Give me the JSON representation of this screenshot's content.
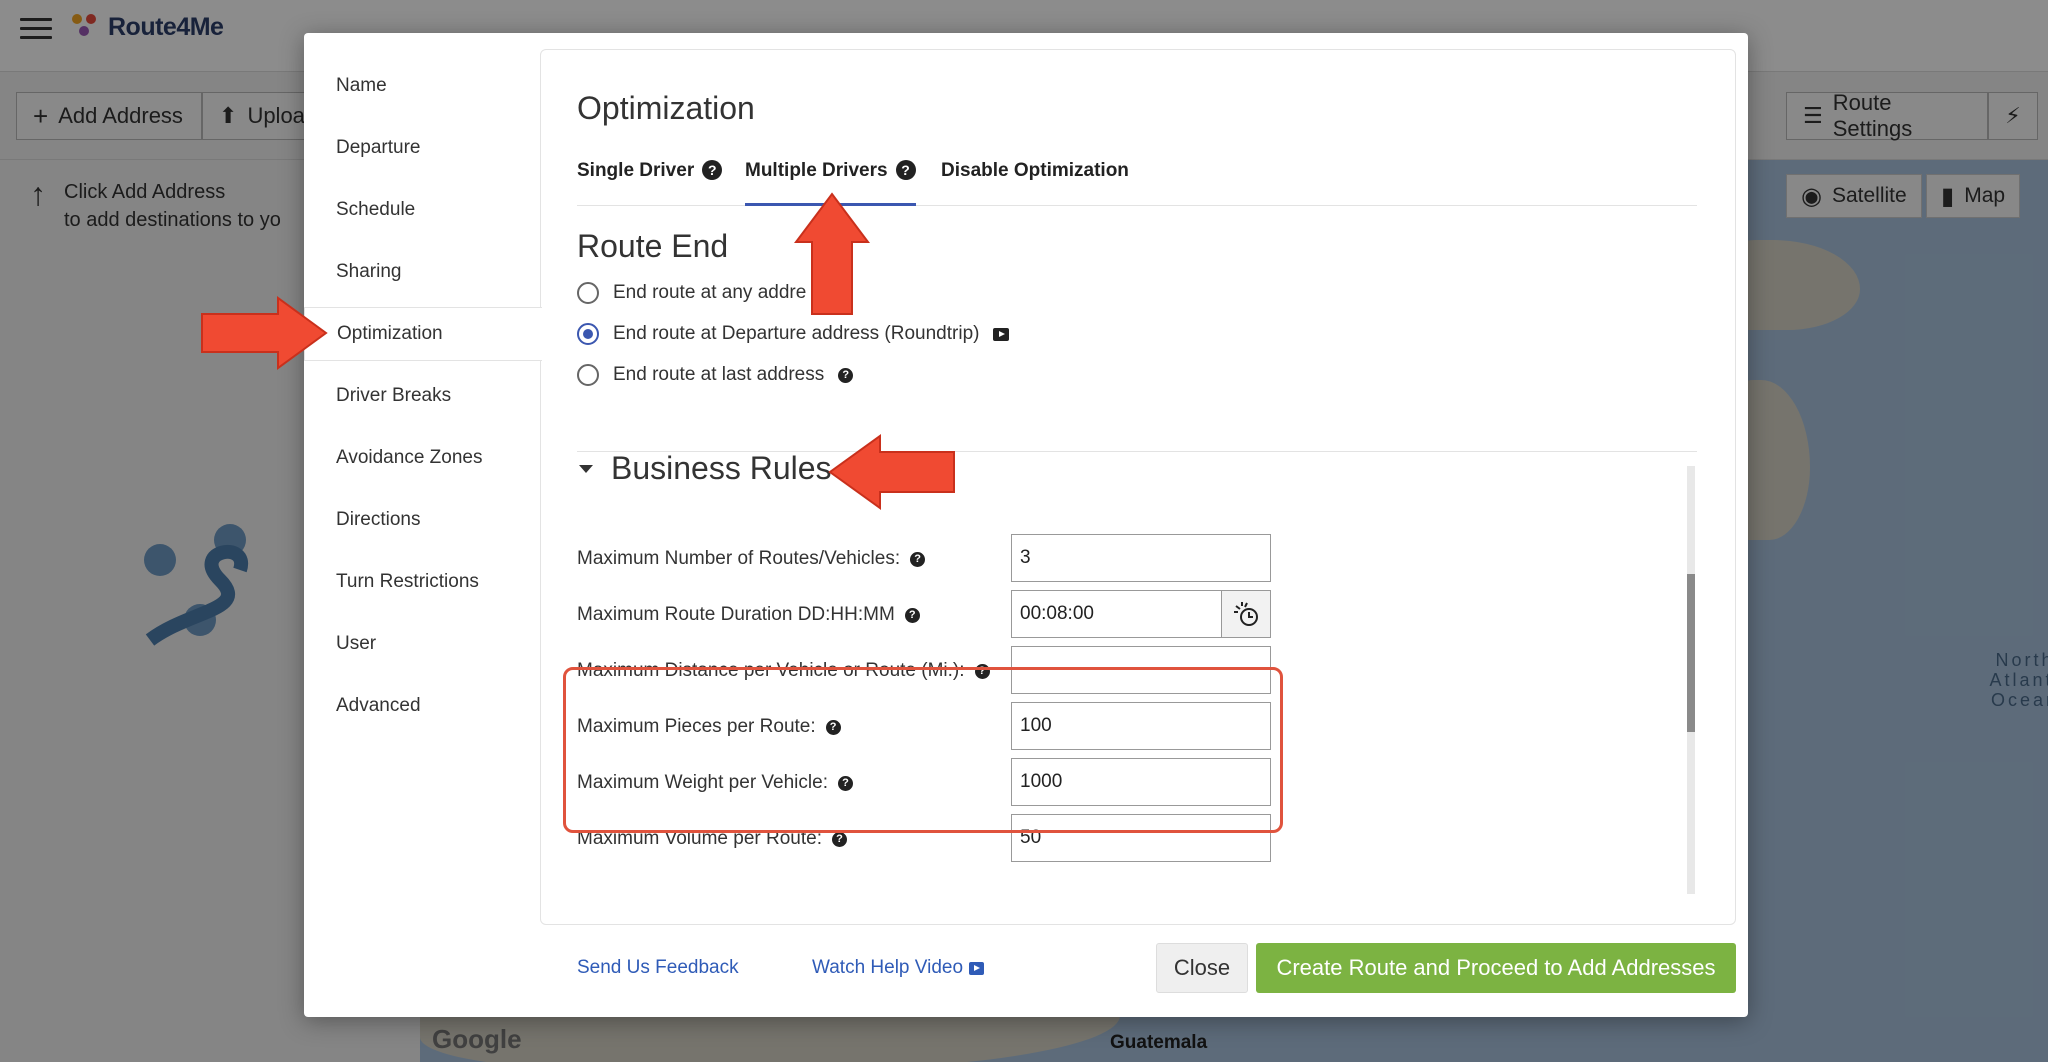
{
  "app": {
    "logo_text": "Route4Me",
    "toolbar": {
      "add_address": "Add Address",
      "upload": "Uploa",
      "route_settings": "Route Settings"
    },
    "hint_line1": "Click Add Address",
    "hint_line2": "to add destinations to yo",
    "map": {
      "satellite": "Satellite",
      "map": "Map",
      "north_atlantic": "North Atlanti Ocean",
      "google": "Google",
      "guatemala": "Guatemala"
    }
  },
  "modal": {
    "nav": [
      "Name",
      "Departure",
      "Schedule",
      "Sharing",
      "Optimization",
      "Driver Breaks",
      "Avoidance Zones",
      "Directions",
      "Turn Restrictions",
      "User",
      "Advanced"
    ],
    "optimization_title": "Optimization",
    "tabs": {
      "single_driver": "Single Driver",
      "multiple_drivers": "Multiple Drivers",
      "disable_optimization": "Disable Optimization"
    },
    "route_end": {
      "title": "Route End",
      "options": [
        "End route at any addre",
        "End route at Departure address (Roundtrip)",
        "End route at last address"
      ]
    },
    "business_rules": {
      "title": "Business Rules",
      "fields": {
        "max_routes_label": "Maximum Number of Routes/Vehicles:",
        "max_routes_value": "3",
        "max_duration_label": "Maximum Route Duration DD:HH:MM",
        "max_duration_value": "00:08:00",
        "max_distance_label": "Maximum Distance per Vehicle or Route (Mi.):",
        "max_distance_value": "",
        "max_pieces_label": "Maximum Pieces per Route:",
        "max_pieces_value": "100",
        "max_weight_label": "Maximum Weight per Vehicle:",
        "max_weight_value": "1000",
        "max_volume_label": "Maximum Volume per Route:",
        "max_volume_value": "50"
      }
    },
    "footer": {
      "feedback": "Send Us Feedback",
      "help_video": "Watch Help Video",
      "close": "Close",
      "create": "Create Route and Proceed to Add Addresses"
    }
  },
  "colors": {
    "accent": "#3b57b0",
    "create_button": "#7cb342",
    "annotation": "#f04a32",
    "highlight_border": "#e0533d"
  }
}
